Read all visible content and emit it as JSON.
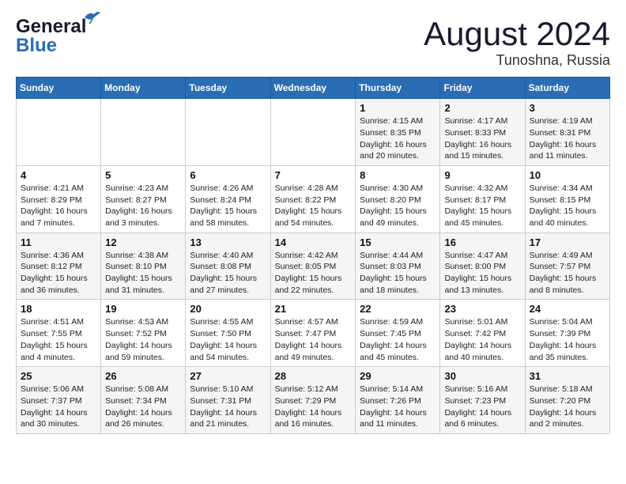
{
  "header": {
    "logo_general": "General",
    "logo_blue": "Blue",
    "month": "August 2024",
    "location": "Tunoshna, Russia"
  },
  "weekdays": [
    "Sunday",
    "Monday",
    "Tuesday",
    "Wednesday",
    "Thursday",
    "Friday",
    "Saturday"
  ],
  "weeks": [
    [
      {
        "day": "",
        "sunrise": "",
        "sunset": "",
        "daylight": ""
      },
      {
        "day": "",
        "sunrise": "",
        "sunset": "",
        "daylight": ""
      },
      {
        "day": "",
        "sunrise": "",
        "sunset": "",
        "daylight": ""
      },
      {
        "day": "",
        "sunrise": "",
        "sunset": "",
        "daylight": ""
      },
      {
        "day": "1",
        "sunrise": "Sunrise: 4:15 AM",
        "sunset": "Sunset: 8:35 PM",
        "daylight": "Daylight: 16 hours and 20 minutes."
      },
      {
        "day": "2",
        "sunrise": "Sunrise: 4:17 AM",
        "sunset": "Sunset: 8:33 PM",
        "daylight": "Daylight: 16 hours and 15 minutes."
      },
      {
        "day": "3",
        "sunrise": "Sunrise: 4:19 AM",
        "sunset": "Sunset: 8:31 PM",
        "daylight": "Daylight: 16 hours and 11 minutes."
      }
    ],
    [
      {
        "day": "4",
        "sunrise": "Sunrise: 4:21 AM",
        "sunset": "Sunset: 8:29 PM",
        "daylight": "Daylight: 16 hours and 7 minutes."
      },
      {
        "day": "5",
        "sunrise": "Sunrise: 4:23 AM",
        "sunset": "Sunset: 8:27 PM",
        "daylight": "Daylight: 16 hours and 3 minutes."
      },
      {
        "day": "6",
        "sunrise": "Sunrise: 4:26 AM",
        "sunset": "Sunset: 8:24 PM",
        "daylight": "Daylight: 15 hours and 58 minutes."
      },
      {
        "day": "7",
        "sunrise": "Sunrise: 4:28 AM",
        "sunset": "Sunset: 8:22 PM",
        "daylight": "Daylight: 15 hours and 54 minutes."
      },
      {
        "day": "8",
        "sunrise": "Sunrise: 4:30 AM",
        "sunset": "Sunset: 8:20 PM",
        "daylight": "Daylight: 15 hours and 49 minutes."
      },
      {
        "day": "9",
        "sunrise": "Sunrise: 4:32 AM",
        "sunset": "Sunset: 8:17 PM",
        "daylight": "Daylight: 15 hours and 45 minutes."
      },
      {
        "day": "10",
        "sunrise": "Sunrise: 4:34 AM",
        "sunset": "Sunset: 8:15 PM",
        "daylight": "Daylight: 15 hours and 40 minutes."
      }
    ],
    [
      {
        "day": "11",
        "sunrise": "Sunrise: 4:36 AM",
        "sunset": "Sunset: 8:12 PM",
        "daylight": "Daylight: 15 hours and 36 minutes."
      },
      {
        "day": "12",
        "sunrise": "Sunrise: 4:38 AM",
        "sunset": "Sunset: 8:10 PM",
        "daylight": "Daylight: 15 hours and 31 minutes."
      },
      {
        "day": "13",
        "sunrise": "Sunrise: 4:40 AM",
        "sunset": "Sunset: 8:08 PM",
        "daylight": "Daylight: 15 hours and 27 minutes."
      },
      {
        "day": "14",
        "sunrise": "Sunrise: 4:42 AM",
        "sunset": "Sunset: 8:05 PM",
        "daylight": "Daylight: 15 hours and 22 minutes."
      },
      {
        "day": "15",
        "sunrise": "Sunrise: 4:44 AM",
        "sunset": "Sunset: 8:03 PM",
        "daylight": "Daylight: 15 hours and 18 minutes."
      },
      {
        "day": "16",
        "sunrise": "Sunrise: 4:47 AM",
        "sunset": "Sunset: 8:00 PM",
        "daylight": "Daylight: 15 hours and 13 minutes."
      },
      {
        "day": "17",
        "sunrise": "Sunrise: 4:49 AM",
        "sunset": "Sunset: 7:57 PM",
        "daylight": "Daylight: 15 hours and 8 minutes."
      }
    ],
    [
      {
        "day": "18",
        "sunrise": "Sunrise: 4:51 AM",
        "sunset": "Sunset: 7:55 PM",
        "daylight": "Daylight: 15 hours and 4 minutes."
      },
      {
        "day": "19",
        "sunrise": "Sunrise: 4:53 AM",
        "sunset": "Sunset: 7:52 PM",
        "daylight": "Daylight: 14 hours and 59 minutes."
      },
      {
        "day": "20",
        "sunrise": "Sunrise: 4:55 AM",
        "sunset": "Sunset: 7:50 PM",
        "daylight": "Daylight: 14 hours and 54 minutes."
      },
      {
        "day": "21",
        "sunrise": "Sunrise: 4:57 AM",
        "sunset": "Sunset: 7:47 PM",
        "daylight": "Daylight: 14 hours and 49 minutes."
      },
      {
        "day": "22",
        "sunrise": "Sunrise: 4:59 AM",
        "sunset": "Sunset: 7:45 PM",
        "daylight": "Daylight: 14 hours and 45 minutes."
      },
      {
        "day": "23",
        "sunrise": "Sunrise: 5:01 AM",
        "sunset": "Sunset: 7:42 PM",
        "daylight": "Daylight: 14 hours and 40 minutes."
      },
      {
        "day": "24",
        "sunrise": "Sunrise: 5:04 AM",
        "sunset": "Sunset: 7:39 PM",
        "daylight": "Daylight: 14 hours and 35 minutes."
      }
    ],
    [
      {
        "day": "25",
        "sunrise": "Sunrise: 5:06 AM",
        "sunset": "Sunset: 7:37 PM",
        "daylight": "Daylight: 14 hours and 30 minutes."
      },
      {
        "day": "26",
        "sunrise": "Sunrise: 5:08 AM",
        "sunset": "Sunset: 7:34 PM",
        "daylight": "Daylight: 14 hours and 26 minutes."
      },
      {
        "day": "27",
        "sunrise": "Sunrise: 5:10 AM",
        "sunset": "Sunset: 7:31 PM",
        "daylight": "Daylight: 14 hours and 21 minutes."
      },
      {
        "day": "28",
        "sunrise": "Sunrise: 5:12 AM",
        "sunset": "Sunset: 7:29 PM",
        "daylight": "Daylight: 14 hours and 16 minutes."
      },
      {
        "day": "29",
        "sunrise": "Sunrise: 5:14 AM",
        "sunset": "Sunset: 7:26 PM",
        "daylight": "Daylight: 14 hours and 11 minutes."
      },
      {
        "day": "30",
        "sunrise": "Sunrise: 5:16 AM",
        "sunset": "Sunset: 7:23 PM",
        "daylight": "Daylight: 14 hours and 6 minutes."
      },
      {
        "day": "31",
        "sunrise": "Sunrise: 5:18 AM",
        "sunset": "Sunset: 7:20 PM",
        "daylight": "Daylight: 14 hours and 2 minutes."
      }
    ]
  ]
}
